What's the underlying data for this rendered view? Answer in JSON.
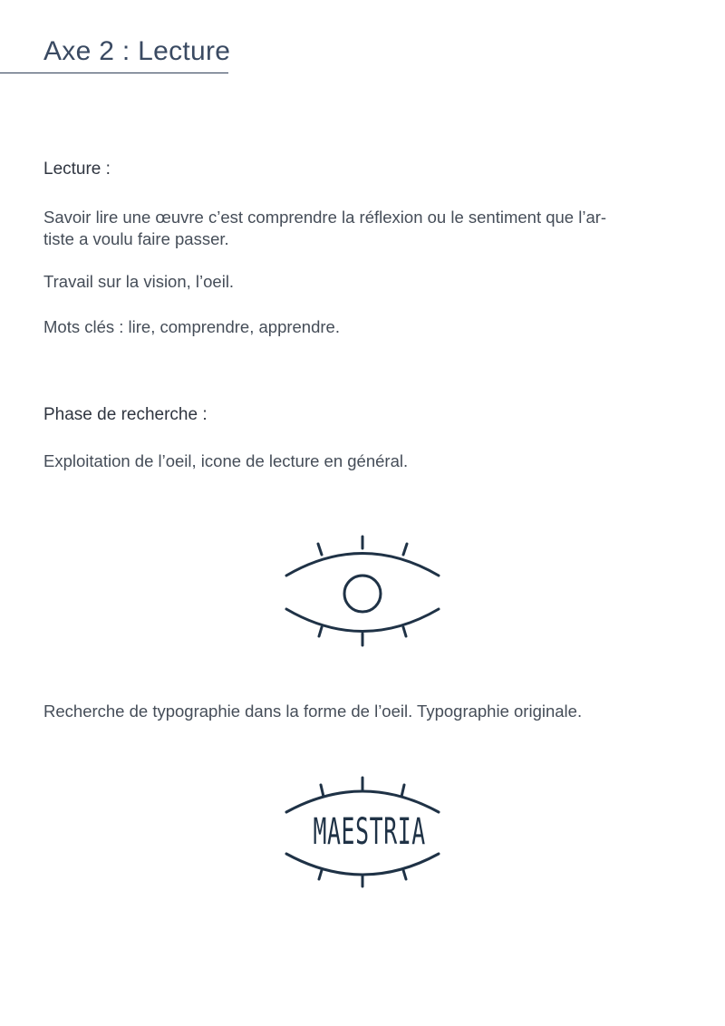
{
  "header": {
    "title": "Axe 2 : Lecture"
  },
  "section_lecture": {
    "heading": "Lecture :",
    "paragraph_1": "Savoir lire une œuvre c’est comprendre la réflexion ou le sentiment que l’ar-tiste a voulu faire passer.",
    "paragraph_1_line_1": "Savoir lire une œuvre c’est comprendre la réflexion ou le sentiment que l’ar-",
    "paragraph_1_line_2": "tiste a voulu faire passer.",
    "paragraph_2": "Travail sur la vision, l’oeil.",
    "paragraph_3": "Mots clés : lire, comprendre, apprendre."
  },
  "section_recherche": {
    "heading": "Phase de recherche :",
    "paragraph_1": "Exploitation de l’oeil, icone de lecture en général.",
    "paragraph_2": "Recherche de typographie dans la forme de l’oeil. Typographie originale."
  },
  "logo": {
    "text": "MAESTRIA",
    "icon_name": "eye-icon",
    "color": "#1f3246"
  },
  "colors": {
    "title": "#3a4a62",
    "rule": "#2e3f57",
    "body_text": "#454d58"
  }
}
